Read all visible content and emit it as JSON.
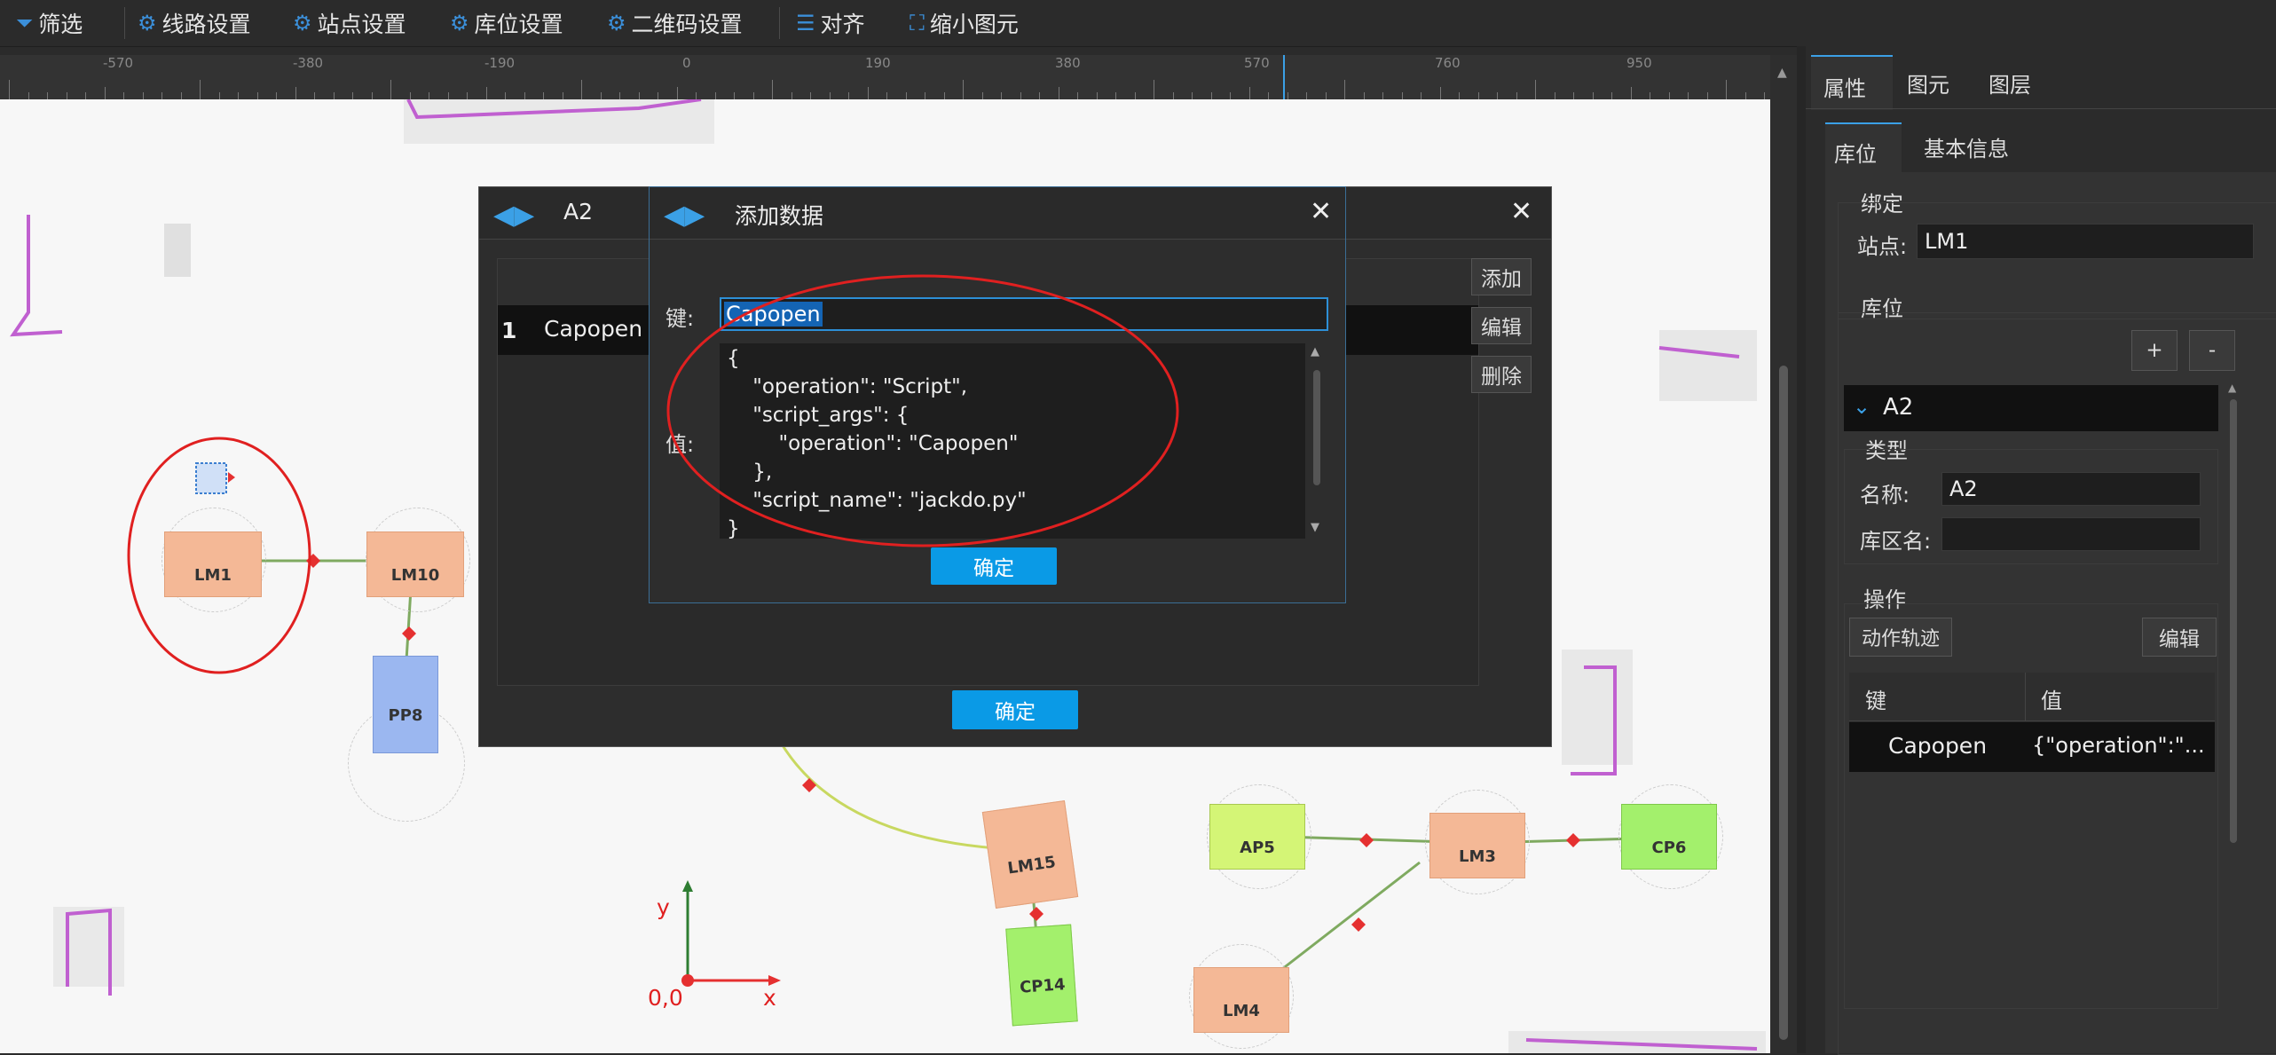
{
  "toolbar": {
    "filter": "筛选",
    "route_settings": "线路设置",
    "station_settings": "站点设置",
    "storage_settings": "库位设置",
    "qrcode_settings": "二维码设置",
    "align": "对齐",
    "shrink": "缩小图元"
  },
  "ruler": {
    "labels": [
      "-570",
      "-380",
      "-190",
      "0",
      "190",
      "380",
      "570",
      "760",
      "950"
    ]
  },
  "canvas": {
    "nodes": {
      "lm1": "LM1",
      "lm10": "LM10",
      "pp8": "PP8",
      "lm15": "LM15",
      "cp14": "CP14",
      "ap5": "AP5",
      "lm3": "LM3",
      "cp6": "CP6",
      "lm4": "LM4"
    },
    "axis": {
      "y": "y",
      "x": "x",
      "origin": "0,0"
    }
  },
  "dialog_a2": {
    "title": "A2",
    "row_index": "1",
    "row_key": "Capopen",
    "add": "添加",
    "edit": "编辑",
    "delete": "删除",
    "confirm": "确定"
  },
  "dialog_add": {
    "title": "添加数据",
    "key_label": "键:",
    "key_value": "Capopen",
    "value_label": "值:",
    "value_lines": [
      "{",
      "    \"operation\": \"Script\",",
      "    \"script_args\": {",
      "        \"operation\": \"Capopen\"",
      "    },",
      "    \"script_name\": \"jackdo.py\"",
      "}"
    ],
    "confirm": "确定"
  },
  "panel": {
    "tabs": [
      "属性",
      "图元",
      "图层"
    ],
    "subtabs": [
      "库位",
      "基本信息"
    ],
    "bind_section": "绑定",
    "station_label": "站点:",
    "station_value": "LM1",
    "storage_section": "库位",
    "plus": "+",
    "minus": "-",
    "item_name": "A2",
    "type_section": "类型",
    "name_label": "名称:",
    "name_value": "A2",
    "area_label": "库区名:",
    "area_value": "",
    "op_section": "操作",
    "action_track": "动作轨迹",
    "edit": "编辑",
    "col_key": "键",
    "col_value": "值",
    "row_key": "Capopen",
    "row_value": "{\"operation\":\"..."
  },
  "colors": {
    "accent_blue": "#0a9ae6",
    "storage_node": "#f4b896",
    "charge_node": "#a3f06c",
    "park_node": "#9bb7f0",
    "annotation_red": "#e02020",
    "route_green": "#7faa60",
    "route_yellow": "#c8d860"
  }
}
